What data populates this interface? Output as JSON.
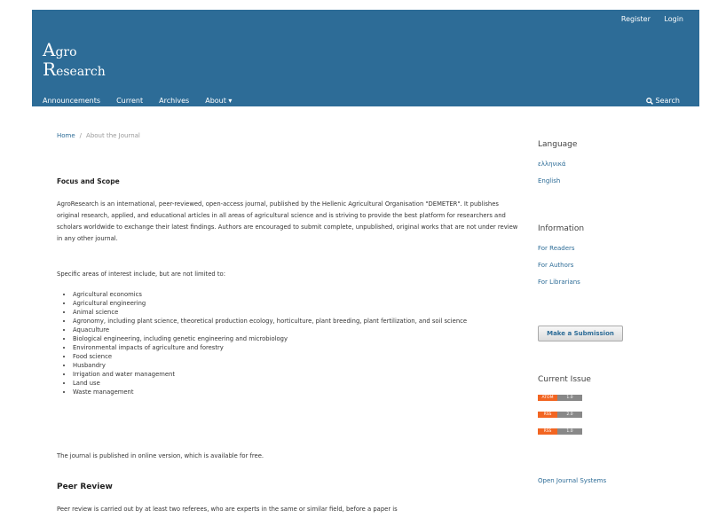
{
  "header": {
    "user_nav": [
      "Register",
      "Login"
    ],
    "logo": {
      "line1_cap": "A",
      "line1_rest": "gro",
      "line2_cap": "R",
      "line2_rest": "esearch"
    },
    "nav": [
      "Announcements",
      "Current",
      "Archives",
      "About ▾"
    ],
    "search_label": "Search"
  },
  "breadcrumb": {
    "home": "Home",
    "separator": "/",
    "current": "About the Journal"
  },
  "main": {
    "focus_title": "Focus and Scope",
    "focus_text": "AgroResearch is an international, peer-reviewed, open-access journal, published by the Hellenic Agricultural Organisation \"DEMETER\". It publishes original research, applied, and educational articles in all areas of agricultural science and is striving to provide the best platform for researchers and scholars worldwide to exchange their latest findings. Authors are encouraged to submit complete, unpublished, original works that are not under review in any other journal.",
    "areas_intro": "Specific areas of interest include, but are not limited to:",
    "areas": [
      "Agricultural economics",
      "Agricultural engineering",
      "Animal science",
      "Agronomy, including plant science, theoretical production ecology, horticulture, plant breeding, plant fertilization, and soil science",
      "Aquaculture",
      "Biological engineering, including genetic engineering and microbiology",
      "Environmental impacts of agriculture and forestry",
      "Food science",
      "Husbandry",
      "Irrigation and water management",
      "Land use",
      "Waste management"
    ],
    "online_note": "The journal is published in online version, which is available for free.",
    "peer_title": "Peer Review",
    "peer_text": "Peer review is carried out by at least two referees, who are experts in the same or similar field, before a paper is"
  },
  "sidebar": {
    "language_title": "Language",
    "languages": [
      "ελληνικά",
      "English"
    ],
    "information_title": "Information",
    "information_links": [
      "For Readers",
      "For Authors",
      "For Librarians"
    ],
    "submit_label": "Make a Submission",
    "current_issue_title": "Current Issue",
    "feeds": [
      {
        "a": "ATOM",
        "b": "1.0"
      },
      {
        "a": "RSS",
        "b": "2.0"
      },
      {
        "a": "RSS",
        "b": "1.0"
      }
    ],
    "ojs_link": "Open Journal Systems"
  },
  "colors": {
    "header_bg": "#2d6c97",
    "link": "#2d6c97",
    "feed_orange": "#f26522"
  }
}
